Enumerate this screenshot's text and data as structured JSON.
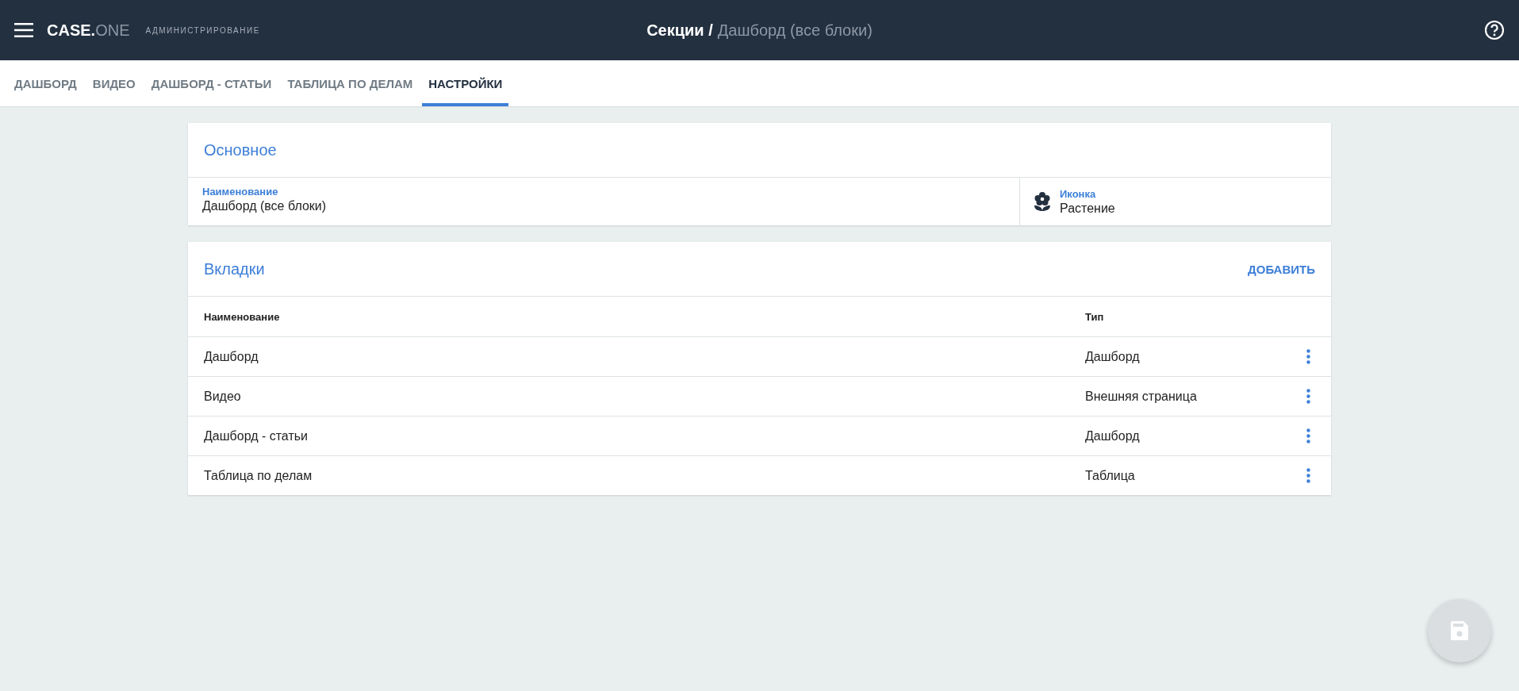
{
  "header": {
    "logo_main": "CASE.",
    "logo_accent": "ONE",
    "subtitle": "АДМИНИСТРИРОВАНИЕ",
    "breadcrumb_parent": "Секции /",
    "breadcrumb_current": "Дашборд (все блоки)"
  },
  "tabs": [
    {
      "label": "ДАШБОРД",
      "selected": false
    },
    {
      "label": "ВИДЕО",
      "selected": false
    },
    {
      "label": "ДАШБОРД - СТАТЬИ",
      "selected": false
    },
    {
      "label": "ТАБЛИЦА ПО ДЕЛАМ",
      "selected": false
    },
    {
      "label": "НАСТРОЙКИ",
      "selected": true
    }
  ],
  "basic": {
    "title": "Основное",
    "name_label": "Наименование",
    "name_value": "Дашборд (все блоки)",
    "icon_label": "Иконка",
    "icon_value": "Растение"
  },
  "tabs_section": {
    "title": "Вкладки",
    "add_button": "ДОБАВИТЬ",
    "columns": [
      "Наименование",
      "Тип"
    ],
    "rows": [
      {
        "name": "Дашборд",
        "type": "Дашборд"
      },
      {
        "name": "Видео",
        "type": "Внешняя страница"
      },
      {
        "name": "Дашборд - статьи",
        "type": "Дашборд"
      },
      {
        "name": "Таблица по делам",
        "type": "Таблица"
      }
    ]
  },
  "save_button": {
    "disabled": true
  }
}
